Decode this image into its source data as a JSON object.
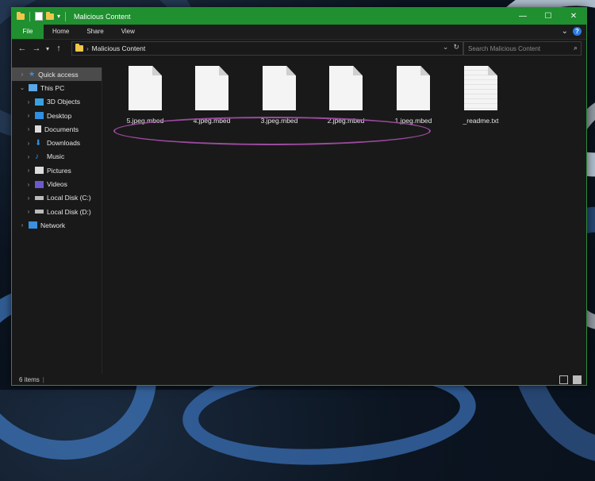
{
  "window": {
    "title": "Malicious Content",
    "qat_dropdown": "▾"
  },
  "window_controls": {
    "minimize": "—",
    "maximize": "☐",
    "close": "✕"
  },
  "ribbon": {
    "tabs": [
      "File",
      "Home",
      "Share",
      "View"
    ],
    "expand": "⌄",
    "help": "?"
  },
  "address": {
    "path": "Malicious Content",
    "search_placeholder": "Search Malicious Content"
  },
  "nav": {
    "back": "←",
    "forward": "→",
    "recent": "▾",
    "up": "↑"
  },
  "sidebar": {
    "items": [
      {
        "label": "Quick access",
        "icon": "star-icon",
        "color": "#3b8fe0"
      },
      {
        "label": "This PC",
        "icon": "computer-icon",
        "color": "#5aa7e8"
      },
      {
        "label": "3D Objects",
        "icon": "cube-icon",
        "color": "#3aa0e0"
      },
      {
        "label": "Desktop",
        "icon": "desktop-icon",
        "color": "#2f8fe0"
      },
      {
        "label": "Documents",
        "icon": "document-icon",
        "color": "#dcdcdc"
      },
      {
        "label": "Downloads",
        "icon": "download-icon",
        "color": "#2f8fe0"
      },
      {
        "label": "Music",
        "icon": "music-icon",
        "color": "#2f8fe0"
      },
      {
        "label": "Pictures",
        "icon": "picture-icon",
        "color": "#dcdcdc"
      },
      {
        "label": "Videos",
        "icon": "video-icon",
        "color": "#6a5acd"
      },
      {
        "label": "Local Disk (C:)",
        "icon": "disk-icon",
        "color": "#bbbbbb"
      },
      {
        "label": "Local Disk (D:)",
        "icon": "disk-icon",
        "color": "#bbbbbb"
      },
      {
        "label": "Network",
        "icon": "network-icon",
        "color": "#3a8fe0"
      }
    ]
  },
  "files": [
    {
      "name": "5.jpeg.mbed",
      "type": "blank"
    },
    {
      "name": "4.jpeg.mbed",
      "type": "blank"
    },
    {
      "name": "3.jpeg.mbed",
      "type": "blank"
    },
    {
      "name": "2.jpeg.mbed",
      "type": "blank"
    },
    {
      "name": "1.jpeg.mbed",
      "type": "blank"
    },
    {
      "name": "_readme.txt",
      "type": "text"
    }
  ],
  "status": {
    "item_count": "6 items"
  },
  "colors": {
    "accent": "#1f8f2f",
    "highlight_oval": "#9b4a9e"
  }
}
